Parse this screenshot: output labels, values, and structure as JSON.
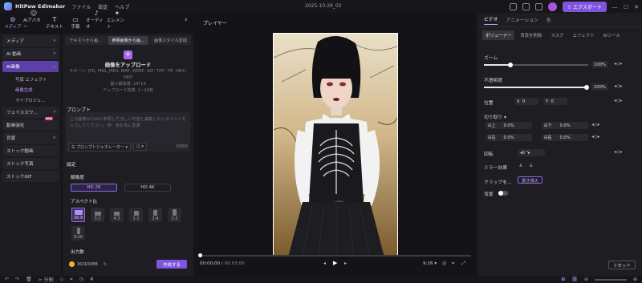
{
  "app": {
    "name": "HitPaw Edimakor",
    "menu": [
      "ファイル",
      "設定",
      "ヘルプ"
    ],
    "project_title": "2025-10-29_02",
    "export": "エクスポート"
  },
  "toolbar": [
    {
      "label": "メディア",
      "icon": "media-icon"
    },
    {
      "label": "AIアバター",
      "icon": "ai-avatar-icon"
    },
    {
      "label": "テキスト",
      "icon": "text-icon"
    },
    {
      "label": "字幕",
      "icon": "subtitle-icon"
    },
    {
      "label": "オーディオ",
      "icon": "audio-icon"
    },
    {
      "label": "エレメント",
      "icon": "element-icon"
    }
  ],
  "sidebar": {
    "items": [
      "メディア",
      "AI 動画",
      "AI画像",
      "写真 エフェクト",
      "画像生成",
      "マイプロジェ...",
      "フェイススワ...",
      "動画強化",
      "背景",
      "ストック動画",
      "ストック写真",
      "ストックGIF"
    ],
    "new_badge": "NEW"
  },
  "panel": {
    "tabs": [
      "テキストから画...",
      "参照画像から画...",
      "画像スタイル変換"
    ],
    "upload_title": "画像をアップロード",
    "upload_support": "サポート: JPG, PNG, JPEG, BMP, WEBP, GIF, TIFF, TIF, HEIC, HEIF",
    "upload_min": "最小解像度: 14*14",
    "upload_count": "アップロード枚数: 1~10枚",
    "prompt_label": "プロンプト",
    "prompt_placeholder": "この画像からAIに参照してほしい内容と編集したいポイントを入力してください。例：色を青に変更",
    "prompt_gen": "プロンプトジェネレーター",
    "prompt_count": "0/800",
    "settings_label": "設定",
    "resolution_label": "解像度",
    "res_options": [
      "HD 2K",
      "HD 4K"
    ],
    "ratio_label": "アスペクト比",
    "ratios": [
      "16:9",
      "3:2",
      "4:3",
      "1:1",
      "3:4",
      "2:3",
      "9:16"
    ],
    "output_label": "出力数",
    "credits": "30/10088",
    "generate": "作成する"
  },
  "player": {
    "title": "プレイヤー",
    "time_current": "00:00:00",
    "time_total": "00:03:00",
    "aspect": "9:16"
  },
  "right": {
    "tabs": [
      "ビデオ",
      "アニメーション",
      "色"
    ],
    "subtabs": [
      "ボリューナー",
      "背景を削除",
      "マスク",
      "エフェクト",
      "AIツール"
    ],
    "zoom_label": "ズーム",
    "zoom_value": "100%",
    "opacity_label": "不透明度",
    "opacity_value": "100%",
    "position_label": "位置",
    "pos_x_label": "X",
    "pos_x": "0",
    "pos_y_label": "Y",
    "pos_y": "0",
    "crop_label": "切り取り",
    "crop_top_label": "上",
    "crop_top": "0.0%",
    "crop_bottom_label": "下",
    "crop_bottom": "0.0%",
    "crop_left_label": "左",
    "crop_left": "0.0%",
    "crop_right_label": "右",
    "crop_right": "0.0%",
    "rotate_label": "回転",
    "rotate_value": "0 °",
    "mirror_label": "ミラー効果",
    "clip_label": "クリップを...",
    "replace": "置き換え",
    "bg_label": "背景",
    "reset": "リセット"
  },
  "bottom": {
    "split": "分割"
  }
}
